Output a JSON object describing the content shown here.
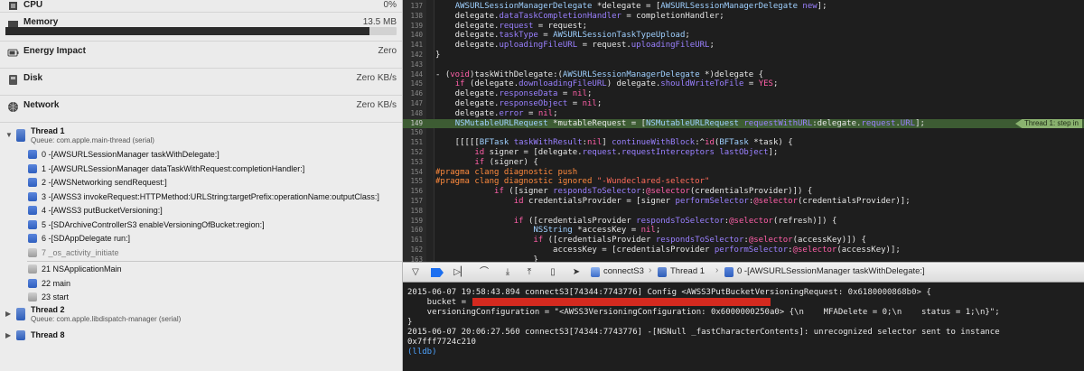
{
  "gauges": {
    "cpu": {
      "name": "CPU",
      "value": "0%"
    },
    "memory": {
      "name": "Memory",
      "value": "13.5 MB",
      "fill": 0.93
    },
    "energy": {
      "name": "Energy Impact",
      "value": "Zero"
    },
    "disk": {
      "name": "Disk",
      "value": "Zero KB/s"
    },
    "network": {
      "name": "Network",
      "value": "Zero KB/s"
    }
  },
  "threads": [
    {
      "name": "Thread 1",
      "queue": "Queue: com.apple.main-thread (serial)",
      "frames": [
        "0 -[AWSURLSessionManager taskWithDelegate:]",
        "1 -[AWSURLSessionManager dataTaskWithRequest:completionHandler:]",
        "2 -[AWSNetworking sendRequest:]",
        "3 -[AWSS3 invokeRequest:HTTPMethod:URLString:targetPrefix:operationName:outputClass:]",
        "4 -[AWSS3 putBucketVersioning:]",
        "5 -[SDArchiveControllerS3 enableVersioningOfBucket:region:]",
        "6 -[SDAppDelegate run:]",
        "7 _os_activity_initiate",
        "21 NSApplicationMain",
        "22 main",
        "23 start"
      ]
    },
    {
      "name": "Thread 2",
      "queue": "Queue: com.apple.libdispatch-manager (serial)"
    },
    {
      "name": "Thread 8"
    }
  ],
  "editor": {
    "line_numbers": [
      "137",
      "138",
      "139",
      "140",
      "141",
      "142",
      "143",
      "144",
      "145",
      "146",
      "147",
      "148",
      "149",
      "150",
      "151",
      "152",
      "153",
      "154",
      "155",
      "156",
      "157",
      "158",
      "159",
      "160",
      "161",
      "162",
      "163"
    ],
    "current_line": "149",
    "badge": "Thread 1: step in"
  },
  "debug_bar": {
    "process": "connectS3",
    "thread": "Thread 1",
    "frame": "0 -[AWSURLSessionManager taskWithDelegate:]"
  },
  "console": {
    "line1": "2015-06-07 19:58:43.894 connectS3[74344:7743776] Config <AWSS3PutBucketVersioningRequest: 0x6180000868b0> {",
    "line2": "    bucket = ",
    "line3": "    versioningConfiguration = \"<AWSS3VersioningConfiguration: 0x6000000250a0> {\\n    MFADelete = 0;\\n    status = 1;\\n}\";",
    "line4": "}",
    "line5": "2015-06-07 20:06:27.560 connectS3[74344:7743776] -[NSNull _fastCharacterContents]: unrecognized selector sent to instance",
    "line6": "0x7fff7724c210",
    "prompt": "(lldb)"
  },
  "colors": {
    "highlight": "#3d5c33",
    "badge": "#8ab26f",
    "redaction": "#d42a1f",
    "prompt": "#4da3ff"
  }
}
